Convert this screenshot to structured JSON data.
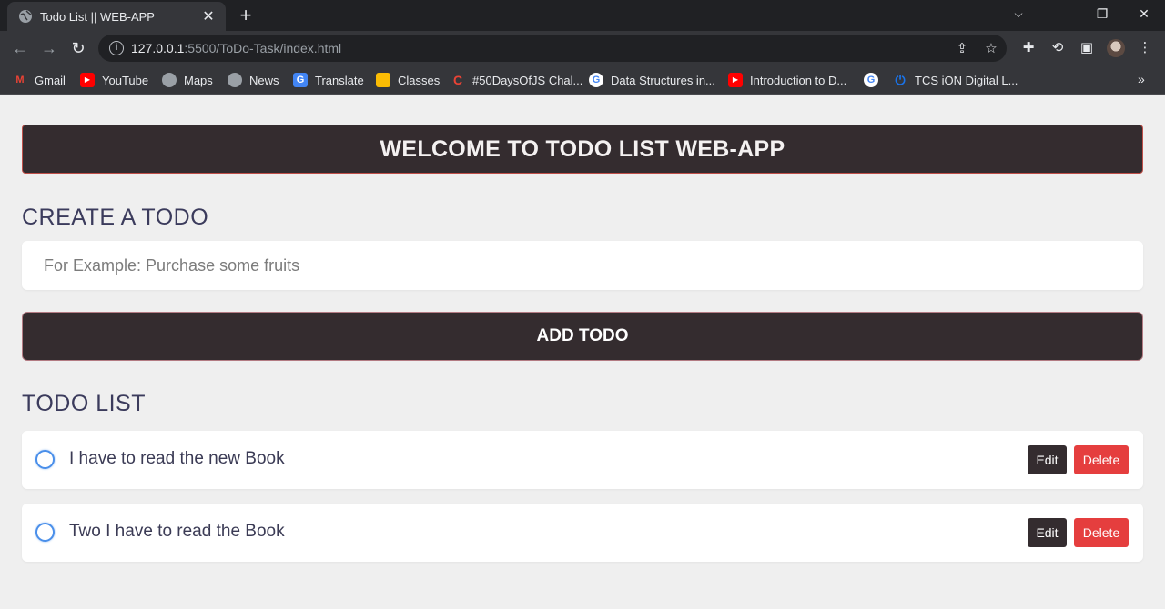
{
  "browser": {
    "tab_title": "Todo List || WEB-APP",
    "tab_close": "✕",
    "new_tab": "+",
    "url_host": "127.0.0.1",
    "url_rest": ":5500/ToDo-Task/index.html",
    "bookmarks": [
      {
        "label": "Gmail",
        "icon": "gmail-icon",
        "glyph": "M",
        "color": "#ea4335"
      },
      {
        "label": "YouTube",
        "icon": "youtube-icon",
        "glyph": "▶",
        "color": "#ff0000"
      },
      {
        "label": "Maps",
        "icon": "globe-icon",
        "glyph": "",
        "color": "#9aa0a6"
      },
      {
        "label": "News",
        "icon": "globe-icon",
        "glyph": "",
        "color": "#9aa0a6"
      },
      {
        "label": "Translate",
        "icon": "translate-icon",
        "glyph": "G",
        "color": "#4285f4"
      },
      {
        "label": "Classes",
        "icon": "classes-icon",
        "glyph": "",
        "color": "#fbbc04"
      },
      {
        "label": "#50DaysOfJS Chal...",
        "icon": "c-icon",
        "glyph": "C",
        "color": "#ea4335"
      },
      {
        "label": "Data Structures in...",
        "icon": "google-icon",
        "glyph": "G",
        "color": "#ffffff"
      },
      {
        "label": "Introduction to D...",
        "icon": "youtube-icon",
        "glyph": "▶",
        "color": "#ff0000"
      },
      {
        "label": "",
        "icon": "google-icon",
        "glyph": "G",
        "color": "#ffffff"
      },
      {
        "label": "TCS iON Digital L...",
        "icon": "power-icon",
        "glyph": "⏻",
        "color": "#1a73e8"
      }
    ],
    "more": "»"
  },
  "app": {
    "header": "WELCOME TO TODO LIST WEB-APP",
    "create_title": "CREATE A TODO",
    "input_placeholder": "For Example: Purchase some fruits",
    "add_button": "ADD TODO",
    "list_title": "TODO LIST",
    "todos": [
      {
        "text": "I have to read the new Book",
        "edit": "Edit",
        "delete": "Delete"
      },
      {
        "text": "Two I have to read the Book",
        "edit": "Edit",
        "delete": "Delete"
      }
    ]
  }
}
